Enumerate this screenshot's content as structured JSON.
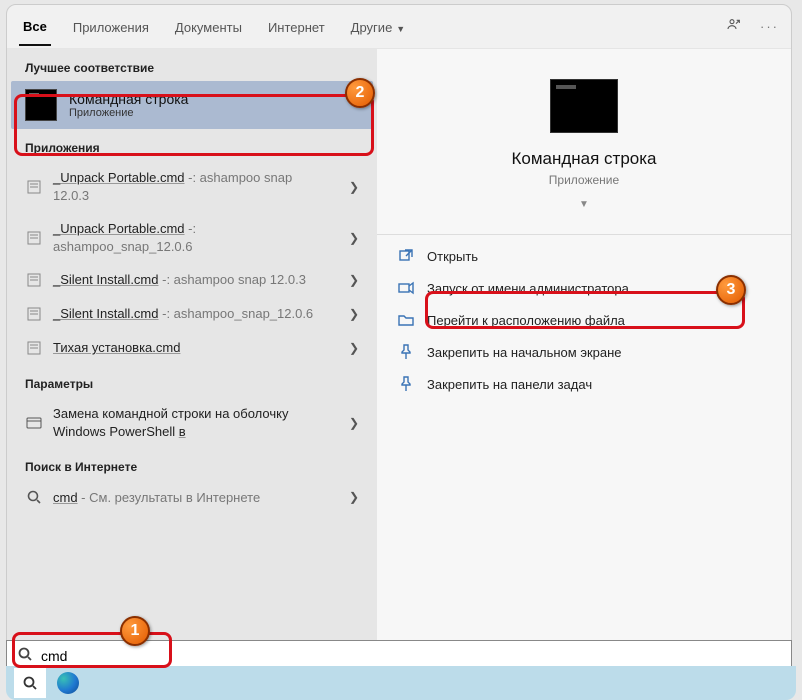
{
  "tabs": {
    "all": "Все",
    "apps": "Приложения",
    "docs": "Документы",
    "internet": "Интернет",
    "other": "Другие"
  },
  "ellipsis": "···",
  "sections": {
    "best_match": "Лучшее соответствие",
    "apps": "Приложения",
    "settings": "Параметры",
    "web": "Поиск в Интернете"
  },
  "best": {
    "title": "Командная строка",
    "sub": "Приложение"
  },
  "app_results": [
    {
      "name": "_Unpack Portable.cmd",
      "hint": " -: ashampoo snap 12.0.3"
    },
    {
      "name": "_Unpack Portable.cmd",
      "hint": " -: ashampoo_snap_12.0.6"
    },
    {
      "name": "_Silent Install.cmd",
      "hint": " -: ashampoo snap 12.0.3"
    },
    {
      "name": "_Silent Install.cmd",
      "hint": " -: ashampoo_snap_12.0.6"
    },
    {
      "name": "Тихая установка.cmd",
      "hint": ""
    }
  ],
  "settings_result_pre": "Замена командной строки на оболочку Windows PowerShell ",
  "settings_result_post": "в",
  "web_result_pre": "cmd",
  "web_result_hint": " - См. результаты в Интернете",
  "preview": {
    "title": "Командная строка",
    "sub": "Приложение"
  },
  "actions": {
    "open": "Открыть",
    "admin": "Запуск от имени администратора",
    "location": "Перейти к расположению файла",
    "pin_start": "Закрепить на начальном экране",
    "pin_taskbar": "Закрепить на панели задач"
  },
  "search": {
    "value": "cmd"
  },
  "markers": {
    "m1": "1",
    "m2": "2",
    "m3": "3"
  }
}
